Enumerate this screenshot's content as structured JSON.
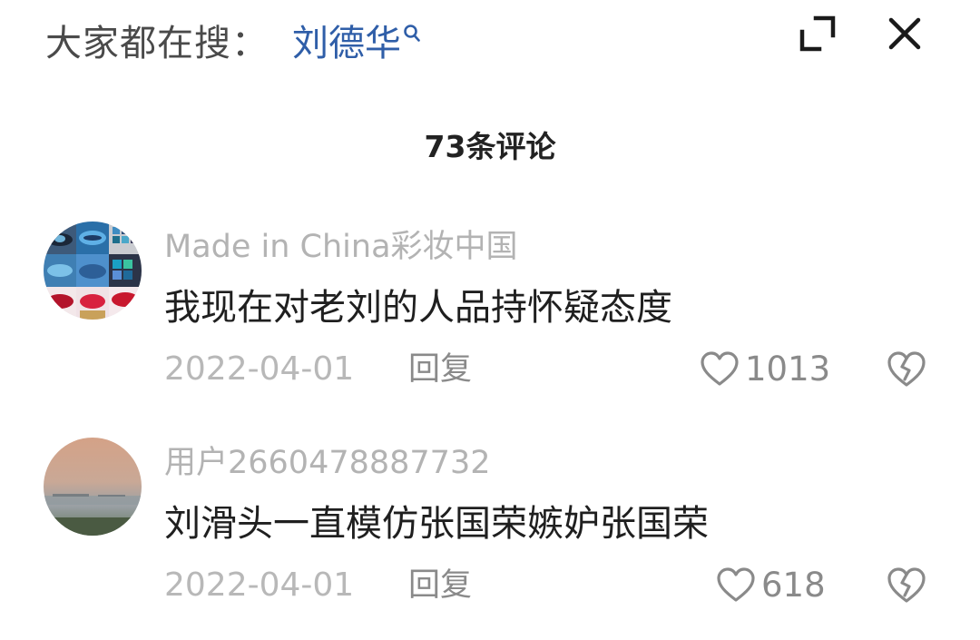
{
  "search_bar": {
    "prefix": "大家都在搜：",
    "term": "刘德华"
  },
  "comments_header": {
    "count_label": "73条评论"
  },
  "comments": [
    {
      "username": "Made in China彩妆中国",
      "text": "我现在对老刘的人品持怀疑态度",
      "date": "2022-04-01",
      "reply_label": "回复",
      "like_count": "1013"
    },
    {
      "username": "用户2660478887732",
      "text": "刘滑头一直模仿张国荣嫉妒张国荣",
      "date": "2022-04-01",
      "reply_label": "回复",
      "like_count": "618"
    }
  ],
  "icons": {
    "search": "search-icon",
    "expand": "expand-icon",
    "close": "close-icon",
    "like": "heart-outline-icon",
    "dislike": "broken-heart-icon"
  },
  "colors": {
    "search_term": "#2f5ea8",
    "primary_text": "#1f1f1f",
    "muted_text": "#b3b3b3"
  }
}
